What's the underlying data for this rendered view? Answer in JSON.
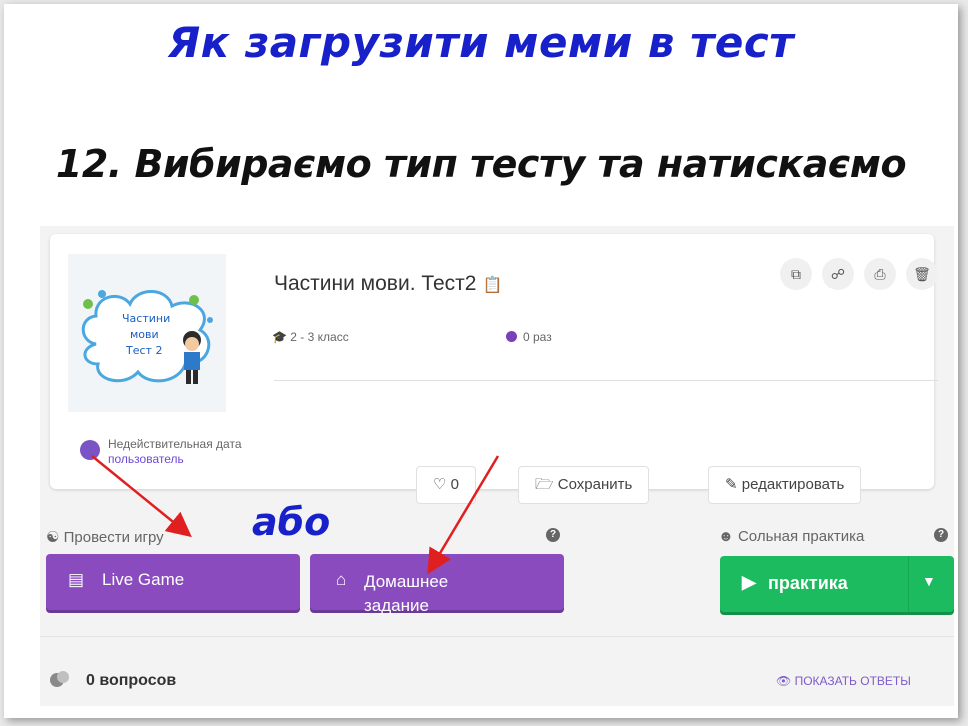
{
  "heading": {
    "title": "Як загрузити меми в тест",
    "step": "12. Вибираємо тип тесту та натискаємо"
  },
  "quiz": {
    "thumbnail_text": [
      "Частини",
      "мови",
      "Тест 2"
    ],
    "name": "Частини мови. Тест2",
    "grade": "2 - 3 класс",
    "plays": "0 раз",
    "user_line1": "Недействительная дата",
    "user_line2": "пользователь"
  },
  "toolbar_icons": [
    "copy-icon",
    "share-icon",
    "print-icon",
    "delete-icon"
  ],
  "actions": {
    "likes": "0",
    "save": "Сохранить",
    "edit": "редактировать"
  },
  "host": {
    "label": "Провести игру",
    "live_game": "Live Game",
    "homework": "Домашнее задание"
  },
  "solo": {
    "label": "Сольная практика",
    "practice": "практика"
  },
  "questions": {
    "count": "0 вопросов",
    "show_answers": "ПОКАЗАТЬ ОТВЕТЫ"
  },
  "annotation": {
    "or": "або",
    "arrow_color": "#e02020"
  },
  "colors": {
    "title": "#1720c9",
    "purple": "#8a4bbf",
    "green": "#1dbb5f",
    "link": "#7d5cc9"
  }
}
